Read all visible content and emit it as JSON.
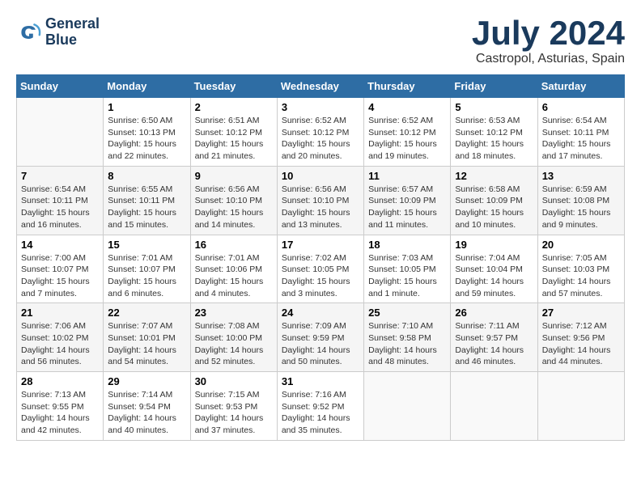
{
  "header": {
    "logo_line1": "General",
    "logo_line2": "Blue",
    "month": "July 2024",
    "location": "Castropol, Asturias, Spain"
  },
  "weekdays": [
    "Sunday",
    "Monday",
    "Tuesday",
    "Wednesday",
    "Thursday",
    "Friday",
    "Saturday"
  ],
  "weeks": [
    [
      {
        "day": "",
        "info": ""
      },
      {
        "day": "1",
        "info": "Sunrise: 6:50 AM\nSunset: 10:13 PM\nDaylight: 15 hours\nand 22 minutes."
      },
      {
        "day": "2",
        "info": "Sunrise: 6:51 AM\nSunset: 10:12 PM\nDaylight: 15 hours\nand 21 minutes."
      },
      {
        "day": "3",
        "info": "Sunrise: 6:52 AM\nSunset: 10:12 PM\nDaylight: 15 hours\nand 20 minutes."
      },
      {
        "day": "4",
        "info": "Sunrise: 6:52 AM\nSunset: 10:12 PM\nDaylight: 15 hours\nand 19 minutes."
      },
      {
        "day": "5",
        "info": "Sunrise: 6:53 AM\nSunset: 10:12 PM\nDaylight: 15 hours\nand 18 minutes."
      },
      {
        "day": "6",
        "info": "Sunrise: 6:54 AM\nSunset: 10:11 PM\nDaylight: 15 hours\nand 17 minutes."
      }
    ],
    [
      {
        "day": "7",
        "info": "Sunrise: 6:54 AM\nSunset: 10:11 PM\nDaylight: 15 hours\nand 16 minutes."
      },
      {
        "day": "8",
        "info": "Sunrise: 6:55 AM\nSunset: 10:11 PM\nDaylight: 15 hours\nand 15 minutes."
      },
      {
        "day": "9",
        "info": "Sunrise: 6:56 AM\nSunset: 10:10 PM\nDaylight: 15 hours\nand 14 minutes."
      },
      {
        "day": "10",
        "info": "Sunrise: 6:56 AM\nSunset: 10:10 PM\nDaylight: 15 hours\nand 13 minutes."
      },
      {
        "day": "11",
        "info": "Sunrise: 6:57 AM\nSunset: 10:09 PM\nDaylight: 15 hours\nand 11 minutes."
      },
      {
        "day": "12",
        "info": "Sunrise: 6:58 AM\nSunset: 10:09 PM\nDaylight: 15 hours\nand 10 minutes."
      },
      {
        "day": "13",
        "info": "Sunrise: 6:59 AM\nSunset: 10:08 PM\nDaylight: 15 hours\nand 9 minutes."
      }
    ],
    [
      {
        "day": "14",
        "info": "Sunrise: 7:00 AM\nSunset: 10:07 PM\nDaylight: 15 hours\nand 7 minutes."
      },
      {
        "day": "15",
        "info": "Sunrise: 7:01 AM\nSunset: 10:07 PM\nDaylight: 15 hours\nand 6 minutes."
      },
      {
        "day": "16",
        "info": "Sunrise: 7:01 AM\nSunset: 10:06 PM\nDaylight: 15 hours\nand 4 minutes."
      },
      {
        "day": "17",
        "info": "Sunrise: 7:02 AM\nSunset: 10:05 PM\nDaylight: 15 hours\nand 3 minutes."
      },
      {
        "day": "18",
        "info": "Sunrise: 7:03 AM\nSunset: 10:05 PM\nDaylight: 15 hours\nand 1 minute."
      },
      {
        "day": "19",
        "info": "Sunrise: 7:04 AM\nSunset: 10:04 PM\nDaylight: 14 hours\nand 59 minutes."
      },
      {
        "day": "20",
        "info": "Sunrise: 7:05 AM\nSunset: 10:03 PM\nDaylight: 14 hours\nand 57 minutes."
      }
    ],
    [
      {
        "day": "21",
        "info": "Sunrise: 7:06 AM\nSunset: 10:02 PM\nDaylight: 14 hours\nand 56 minutes."
      },
      {
        "day": "22",
        "info": "Sunrise: 7:07 AM\nSunset: 10:01 PM\nDaylight: 14 hours\nand 54 minutes."
      },
      {
        "day": "23",
        "info": "Sunrise: 7:08 AM\nSunset: 10:00 PM\nDaylight: 14 hours\nand 52 minutes."
      },
      {
        "day": "24",
        "info": "Sunrise: 7:09 AM\nSunset: 9:59 PM\nDaylight: 14 hours\nand 50 minutes."
      },
      {
        "day": "25",
        "info": "Sunrise: 7:10 AM\nSunset: 9:58 PM\nDaylight: 14 hours\nand 48 minutes."
      },
      {
        "day": "26",
        "info": "Sunrise: 7:11 AM\nSunset: 9:57 PM\nDaylight: 14 hours\nand 46 minutes."
      },
      {
        "day": "27",
        "info": "Sunrise: 7:12 AM\nSunset: 9:56 PM\nDaylight: 14 hours\nand 44 minutes."
      }
    ],
    [
      {
        "day": "28",
        "info": "Sunrise: 7:13 AM\nSunset: 9:55 PM\nDaylight: 14 hours\nand 42 minutes."
      },
      {
        "day": "29",
        "info": "Sunrise: 7:14 AM\nSunset: 9:54 PM\nDaylight: 14 hours\nand 40 minutes."
      },
      {
        "day": "30",
        "info": "Sunrise: 7:15 AM\nSunset: 9:53 PM\nDaylight: 14 hours\nand 37 minutes."
      },
      {
        "day": "31",
        "info": "Sunrise: 7:16 AM\nSunset: 9:52 PM\nDaylight: 14 hours\nand 35 minutes."
      },
      {
        "day": "",
        "info": ""
      },
      {
        "day": "",
        "info": ""
      },
      {
        "day": "",
        "info": ""
      }
    ]
  ]
}
